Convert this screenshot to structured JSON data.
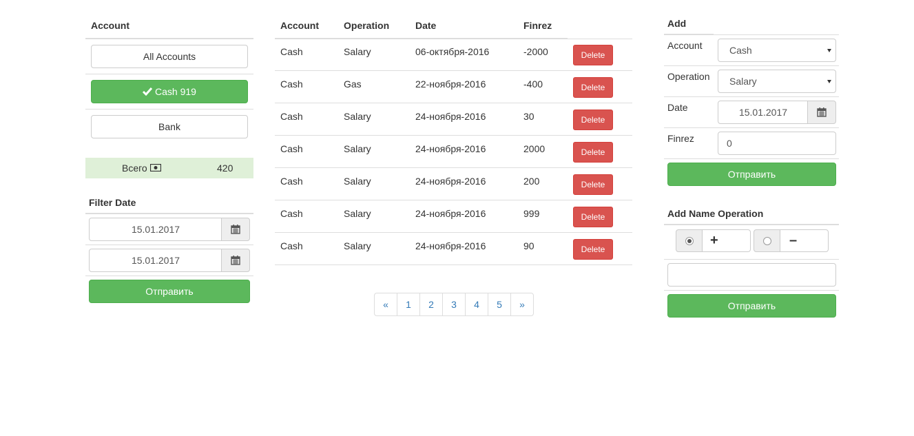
{
  "left": {
    "account_header": "Account",
    "accounts": [
      "All Accounts",
      "Cash 919",
      "Bank"
    ],
    "total_label": "Всего",
    "total_value": "420",
    "filter_header": "Filter Date",
    "date_from": "15.01.2017",
    "date_to": "15.01.2017",
    "submit_label": "Отправить"
  },
  "table": {
    "headers": [
      "Account",
      "Operation",
      "Date",
      "Finrez"
    ],
    "delete_label": "Delete",
    "rows": [
      [
        "Cash",
        "Salary",
        "06-октября-2016",
        "-2000"
      ],
      [
        "Cash",
        "Gas",
        "22-ноября-2016",
        "-400"
      ],
      [
        "Cash",
        "Salary",
        "24-ноября-2016",
        "30"
      ],
      [
        "Cash",
        "Salary",
        "24-ноября-2016",
        "2000"
      ],
      [
        "Cash",
        "Salary",
        "24-ноября-2016",
        "200"
      ],
      [
        "Cash",
        "Salary",
        "24-ноября-2016",
        "999"
      ],
      [
        "Cash",
        "Salary",
        "24-ноября-2016",
        "90"
      ]
    ]
  },
  "pagination": [
    "«",
    "1",
    "2",
    "3",
    "4",
    "5",
    "»"
  ],
  "add": {
    "header": "Add",
    "account_label": "Account",
    "account_value": "Cash",
    "operation_label": "Operation",
    "operation_value": "Salary",
    "date_label": "Date",
    "date_value": "15.01.2017",
    "finrez_label": "Finrez",
    "finrez_value": "0",
    "submit_label": "Отправить"
  },
  "add_operation": {
    "header": "Add Name Operation",
    "plus": "+",
    "minus": "–",
    "name_value": "",
    "submit_label": "Отправить"
  },
  "colors": {
    "success": "#5cb85c",
    "danger": "#d9534f",
    "link": "#337ab7",
    "total_bg": "#dff0d8"
  }
}
